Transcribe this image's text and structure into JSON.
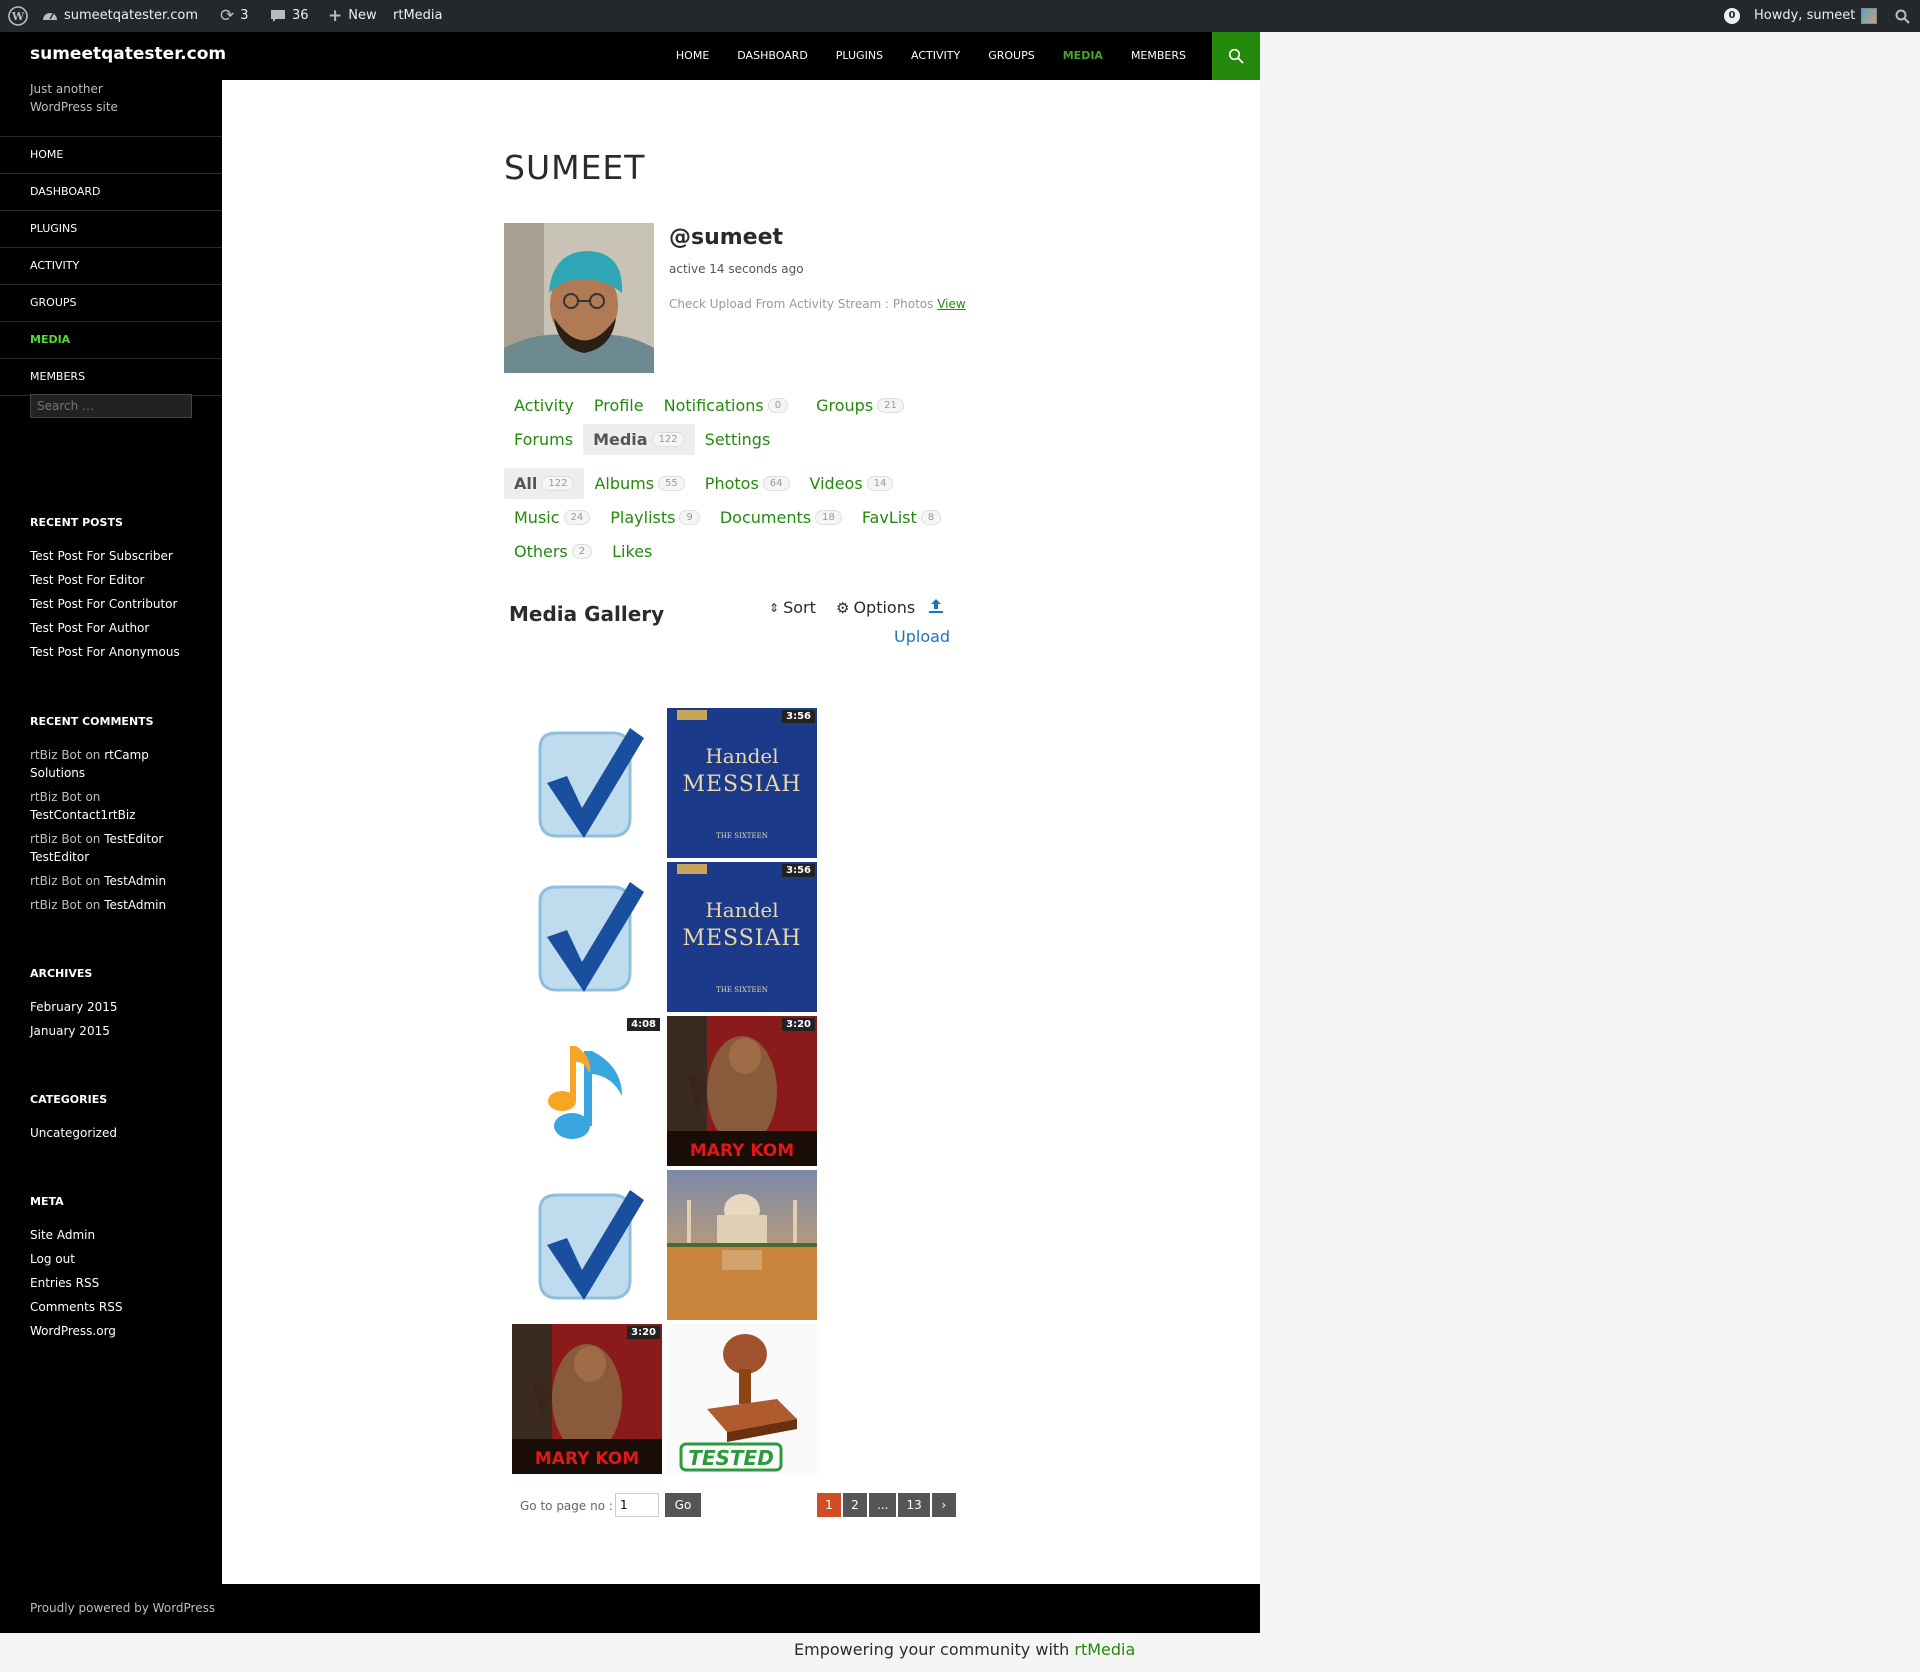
{
  "adminbar": {
    "site": "sumeetqatester.com",
    "updates": "3",
    "comments": "36",
    "new_label": "New",
    "rtmedia": "rtMedia",
    "notif_count": "0",
    "howdy": "Howdy, sumeet"
  },
  "site": {
    "title": "sumeetqatester.com",
    "tagline": "Just another WordPress site"
  },
  "primary_nav": [
    "HOME",
    "DASHBOARD",
    "PLUGINS",
    "ACTIVITY",
    "GROUPS",
    "MEDIA",
    "MEMBERS"
  ],
  "side_nav": [
    "HOME",
    "DASHBOARD",
    "PLUGINS",
    "ACTIVITY",
    "GROUPS",
    "MEDIA",
    "MEMBERS"
  ],
  "search_placeholder": "Search …",
  "widgets": {
    "recent_posts": {
      "title": "RECENT POSTS",
      "items": [
        "Test Post For Subscriber",
        "Test Post For Editor",
        "Test Post For Contributor",
        "Test Post For Author",
        "Test Post For Anonymous"
      ]
    },
    "recent_comments": {
      "title": "RECENT COMMENTS",
      "items": [
        {
          "author": "rtBiz Bot",
          "on": "on",
          "post": "rtCamp Solutions"
        },
        {
          "author": "rtBiz Bot",
          "on": "on",
          "post": "TestContact1rtBiz"
        },
        {
          "author": "rtBiz Bot",
          "on": "on",
          "post": "TestEditor TestEditor"
        },
        {
          "author": "rtBiz Bot",
          "on": "on",
          "post": "TestAdmin"
        },
        {
          "author": "rtBiz Bot",
          "on": "on",
          "post": "TestAdmin"
        }
      ]
    },
    "archives": {
      "title": "ARCHIVES",
      "items": [
        "February 2015",
        "January 2015"
      ]
    },
    "categories": {
      "title": "CATEGORIES",
      "items": [
        "Uncategorized"
      ]
    },
    "meta": {
      "title": "META",
      "items": [
        "Site Admin",
        "Log out",
        "Entries RSS",
        "Comments RSS",
        "WordPress.org"
      ]
    }
  },
  "footer_credit": "Proudly powered by WordPress",
  "profile": {
    "page_title": "SUMEET",
    "username": "@sumeet",
    "active": "active 14 seconds ago",
    "upload_note": "Check Upload From Activity Stream : Photos",
    "view_link": "View"
  },
  "member_tabs": [
    {
      "label": "Activity"
    },
    {
      "label": "Profile"
    },
    {
      "label": "Notifications",
      "count": "0"
    },
    {
      "label": "Groups",
      "count": "21"
    },
    {
      "label": "Forums"
    },
    {
      "label": "Media",
      "count": "122"
    },
    {
      "label": "Settings"
    }
  ],
  "media_tabs": [
    {
      "label": "All",
      "count": "122"
    },
    {
      "label": "Albums",
      "count": "55"
    },
    {
      "label": "Photos",
      "count": "64"
    },
    {
      "label": "Videos",
      "count": "14"
    },
    {
      "label": "Music",
      "count": "24"
    },
    {
      "label": "Playlists",
      "count": "9"
    },
    {
      "label": "Documents",
      "count": "18"
    },
    {
      "label": "FavList",
      "count": "8"
    },
    {
      "label": "Others",
      "count": "2"
    },
    {
      "label": "Likes"
    }
  ],
  "gallery": {
    "title": "Media Gallery",
    "sort": "Sort",
    "options": "Options",
    "upload": "Upload",
    "items": [
      {
        "kind": "checkmark"
      },
      {
        "kind": "messiah",
        "duration": "3:56",
        "line1": "Handel",
        "line2": "MESSIAH",
        "line3": "THE SIXTEEN"
      },
      {
        "kind": "checkmark"
      },
      {
        "kind": "messiah",
        "duration": "3:56",
        "line1": "Handel",
        "line2": "MESSIAH",
        "line3": "THE SIXTEEN"
      },
      {
        "kind": "music-note",
        "duration": "4:08"
      },
      {
        "kind": "marykom",
        "duration": "3:20",
        "caption": "MARY KOM"
      },
      {
        "kind": "checkmark"
      },
      {
        "kind": "tajmahal"
      },
      {
        "kind": "marykom",
        "duration": "3:20",
        "caption": "MARY KOM"
      },
      {
        "kind": "stamp",
        "caption": "TESTED"
      }
    ]
  },
  "pagination": {
    "goto_label": "Go to page no :",
    "goto_value": "1",
    "go": "Go",
    "pages": [
      "1",
      "2",
      "...",
      "13",
      "›"
    ],
    "current": "1"
  },
  "rtmedia_credit": {
    "text": "Empowering your community with",
    "link": "rtMedia"
  },
  "colors": {
    "accent": "#24890d",
    "active_link": "#41a62a",
    "current_page": "#d14d23"
  }
}
